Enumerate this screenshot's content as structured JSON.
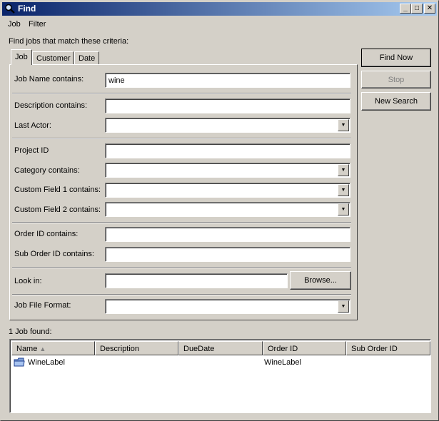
{
  "window": {
    "title": "Find",
    "minimize": "_",
    "maximize": "□",
    "close": "✕"
  },
  "menu": {
    "job": "Job",
    "filter": "Filter"
  },
  "criteria_label": "Find jobs that match these criteria:",
  "tabs": [
    {
      "label": "Job"
    },
    {
      "label": "Customer"
    },
    {
      "label": "Date"
    }
  ],
  "fields": {
    "job_name": {
      "label": "Job Name contains:",
      "value": "wine"
    },
    "description": {
      "label": "Description contains:",
      "value": ""
    },
    "last_actor": {
      "label": "Last Actor:",
      "value": ""
    },
    "project_id": {
      "label": "Project ID",
      "value": ""
    },
    "category": {
      "label": "Category contains:",
      "value": ""
    },
    "custom1": {
      "label": "Custom Field 1 contains:",
      "value": ""
    },
    "custom2": {
      "label": "Custom Field 2 contains:",
      "value": ""
    },
    "order_id": {
      "label": "Order ID contains:",
      "value": ""
    },
    "sub_order_id": {
      "label": "Sub Order ID contains:",
      "value": ""
    },
    "look_in": {
      "label": "Look in:",
      "value": ""
    },
    "job_file_format": {
      "label": "Job File Format:",
      "value": ""
    }
  },
  "buttons": {
    "find_now": "Find Now",
    "stop": "Stop",
    "new_search": "New Search",
    "browse": "Browse..."
  },
  "results": {
    "count_label": "1 Job found:",
    "columns": [
      "Name",
      "Description",
      "DueDate",
      "Order ID",
      "Sub Order ID"
    ],
    "sort_indicator": "▲",
    "rows": [
      {
        "name": "WineLabel",
        "description": "",
        "due_date": "",
        "order_id": "WineLabel",
        "sub_order_id": ""
      }
    ]
  },
  "icons": {
    "title": "magnifier-icon",
    "row": "folder-icon",
    "combo": "dropdown-arrow-icon"
  }
}
